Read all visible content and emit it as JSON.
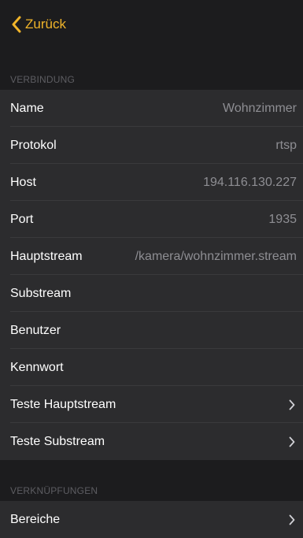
{
  "nav": {
    "back_label": "Zurück"
  },
  "sections": [
    {
      "header": "VERBINDUNG",
      "rows": [
        {
          "label": "Name",
          "value": "Wohnzimmer"
        },
        {
          "label": "Protokol",
          "value": "rtsp"
        },
        {
          "label": "Host",
          "value": "194.116.130.227"
        },
        {
          "label": "Port",
          "value": "1935"
        },
        {
          "label": "Hauptstream",
          "value": "/kamera/wohnzimmer.stream"
        },
        {
          "label": "Substream",
          "value": ""
        },
        {
          "label": "Benutzer",
          "value": ""
        },
        {
          "label": "Kennwort",
          "value": ""
        },
        {
          "label": "Teste Hauptstream",
          "accessory": "chevron-right-icon"
        },
        {
          "label": "Teste Substream",
          "accessory": "chevron-right-icon"
        }
      ]
    },
    {
      "header": "VERKNÜPFUNGEN",
      "rows": [
        {
          "label": "Bereiche",
          "accessory": "chevron-right-icon"
        }
      ]
    }
  ],
  "colors": {
    "background": "#1c1c1e",
    "cell_background": "#2c2c2e",
    "accent": "#f0b42a",
    "secondary_text": "#8e8e93",
    "header_text": "#5d5d62",
    "separator": "#3a3a3c"
  },
  "icons": {
    "back": "chevron-left-icon",
    "disclosure": "chevron-right-icon"
  }
}
